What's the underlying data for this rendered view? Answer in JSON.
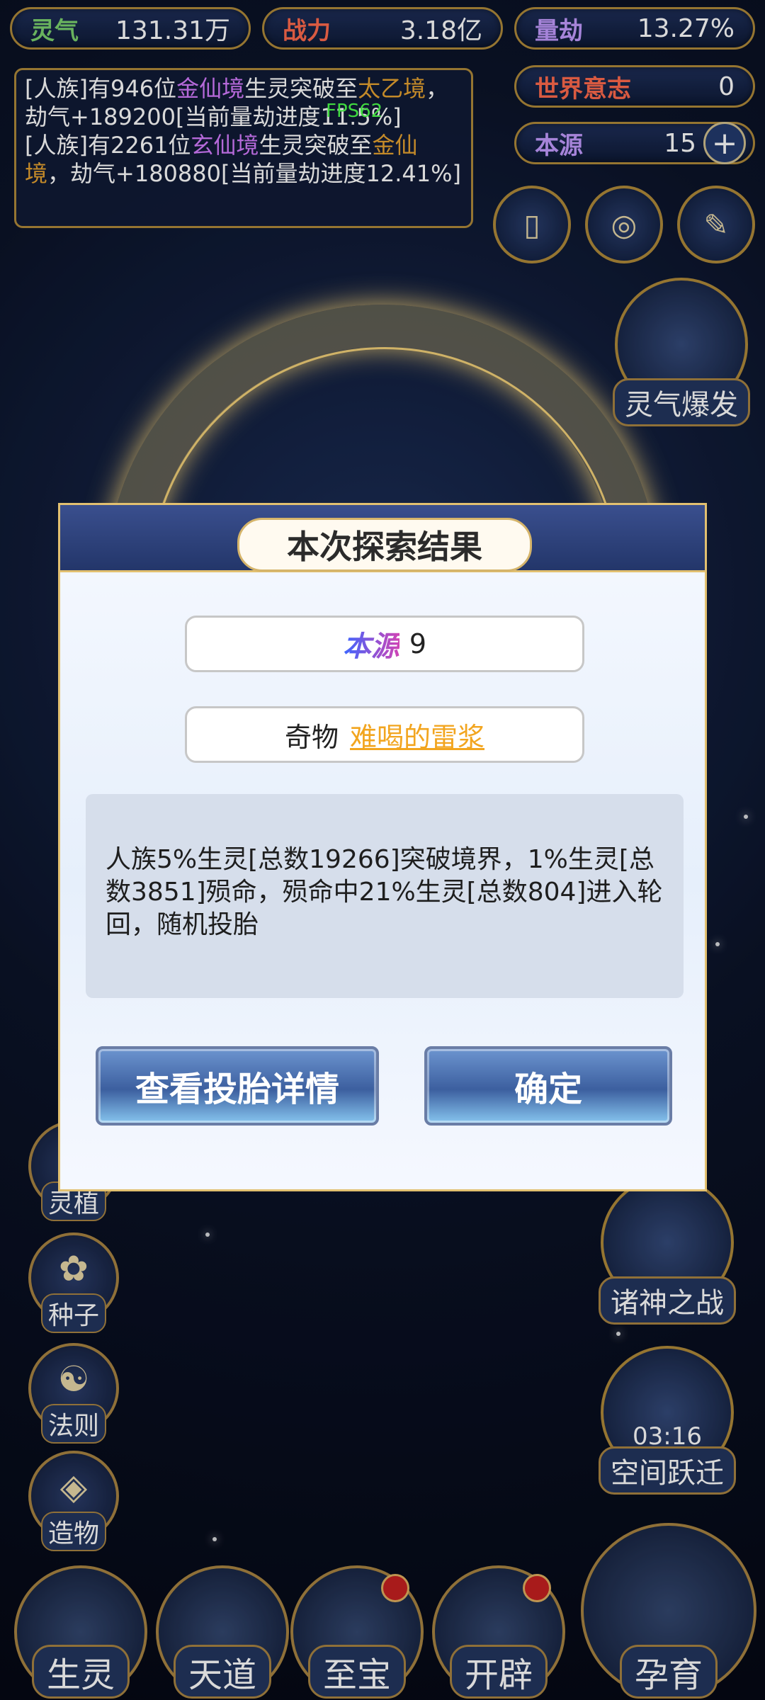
{
  "stats": {
    "lingqi": {
      "label": "灵气",
      "value": "131.31万"
    },
    "zhanli": {
      "label": "战力",
      "value": "3.18亿"
    },
    "liangjie": {
      "label": "量劫",
      "value": "13.27%"
    },
    "shijie": {
      "label": "世界意志",
      "value": "0"
    },
    "benyuan": {
      "label": "本源",
      "value": "15"
    }
  },
  "log": {
    "line1": {
      "a": "[人族]有946位",
      "b": "金仙境",
      "c": "生灵突破至",
      "d": "太乙境",
      "e": "，劫气+189200[当前量劫进度11.5%]"
    },
    "line2": {
      "a": "[人族]有2261位",
      "b": "玄仙境",
      "c": "生灵突破至",
      "d": "金仙境",
      "e": "，劫气+180880[当前量劫进度12.41%]"
    }
  },
  "fps": "FPS62",
  "side_buttons": [
    "灵植",
    "种子",
    "法则",
    "造物"
  ],
  "right_buttons": {
    "burst": "灵气爆发",
    "war": "诸神之战",
    "jump": "空间跃迁",
    "timer": "03:16"
  },
  "bottom_buttons": [
    "生灵",
    "天道",
    "至宝",
    "开辟",
    "孕育"
  ],
  "modal": {
    "title": "本次探索结果",
    "reward1_name": "本源",
    "reward1_value": "9",
    "reward2_type": "奇物",
    "reward2_name": "难喝的雷浆",
    "description": "人族5%生灵[总数19266]突破境界，1%生灵[总数3851]殒命，殒命中21%生灵[总数804]进入轮回，随机投胎",
    "btn_detail": "查看投胎详情",
    "btn_ok": "确定"
  }
}
